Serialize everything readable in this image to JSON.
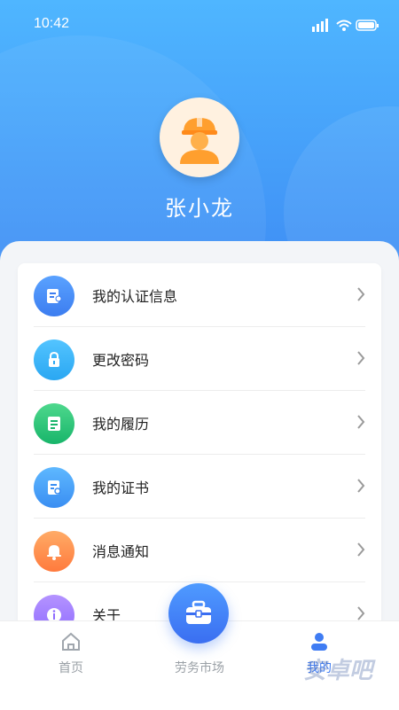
{
  "status_bar": {
    "time": "10:42"
  },
  "profile": {
    "name": "张小龙"
  },
  "menu": {
    "items": [
      {
        "label": "我的认证信息",
        "icon": "id-card-icon",
        "color_from": "#5aa2ff",
        "color_to": "#3c7df0"
      },
      {
        "label": "更改密码",
        "icon": "lock-icon",
        "color_from": "#53c4ff",
        "color_to": "#2aa7f2"
      },
      {
        "label": "我的履历",
        "icon": "document-icon",
        "color_from": "#4ed88d",
        "color_to": "#18b56a"
      },
      {
        "label": "我的证书",
        "icon": "certificate-icon",
        "color_from": "#5eb8ff",
        "color_to": "#3a8ef2"
      },
      {
        "label": "消息通知",
        "icon": "bell-icon",
        "color_from": "#ffab66",
        "color_to": "#ff7a3d"
      },
      {
        "label": "关于",
        "icon": "info-icon",
        "color_from": "#b493ff",
        "color_to": "#8f6cff"
      }
    ]
  },
  "tabbar": {
    "home": "首页",
    "market": "劳务市场",
    "me": "我的"
  },
  "watermark": "安卓吧"
}
